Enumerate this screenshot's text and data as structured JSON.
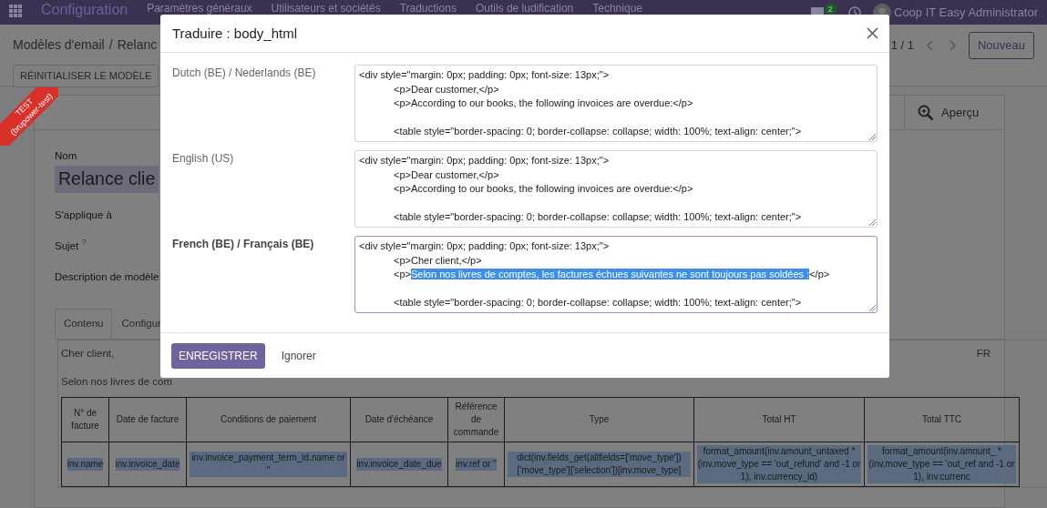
{
  "navbar": {
    "brand": "Configuration",
    "menus": [
      "Paramètres généraux",
      "Utilisateurs et sociétés",
      "Traductions",
      "Outils de ludification",
      "Technique"
    ],
    "message_count": "2",
    "user": "Coop IT Easy Administrator"
  },
  "ribbon": {
    "lines": [
      "TEST",
      "(brupower-test)"
    ]
  },
  "control_panel": {
    "breadcrumbs": [
      "Modèles d'email",
      "Relanc"
    ],
    "breadcrumb_separator": "/",
    "action_button": "RÉINITIALISER LE MODÈLE",
    "pager": "1 / 1",
    "new_button": "Nouveau"
  },
  "form": {
    "stat_button": "Aperçu",
    "fields": [
      {
        "label": "Nom",
        "kind": "title"
      },
      {
        "label": "S'applique à",
        "kind": "plain"
      },
      {
        "label": "Sujet",
        "kind": "help",
        "help": "?"
      },
      {
        "label": "Description de modèle",
        "kind": "plain"
      }
    ],
    "name_value": "Relance clie",
    "tabs": [
      {
        "label": "Contenu",
        "selected": true
      },
      {
        "label": "Configur",
        "selected": false
      }
    ],
    "body": {
      "greeting": "Cher client,",
      "language": "FR",
      "intro": "Selon nos livres de com",
      "table": {
        "columns": [
          "N° de facture",
          "Date de facture",
          "Conditions de paiement",
          "Date d'échéance",
          "Référence de commande",
          "Type",
          "Total HT",
          "Total TTC"
        ],
        "rows": [
          {
            "selected": true,
            "cells": [
              "inv.name",
              "inv.invoice_date",
              "inv.invoice_payment_term_id.name or ''",
              "inv.invoice_date_due",
              "inv.ref or ''",
              "dict(inv.fields_get(allfields=['move_type'])['move_type']['selection'])[inv.move_type]",
              "format_amount(inv.amount_untaxed * (inv.move_type == 'out_refund' and -1 or 1), inv.currency_id)",
              "format_amount(inv.amount_ * (inv.move_type == 'out_ref and -1 or 1), inv.currenc"
            ]
          }
        ]
      }
    }
  },
  "modal": {
    "title": "Traduire : body_html",
    "rows": [
      {
        "language": "Dutch (BE) / Nederlands (BE)",
        "focused": false,
        "lines": [
          {
            "text": "<div style=\"margin: 0px; padding: 0px; font-size: 13px;\">",
            "indented": false
          },
          {
            "text": "<p>Dear customer,</p>",
            "indented": true
          },
          {
            "text": "<p>According to our books, the following invoices are overdue:</p>",
            "indented": true
          },
          {
            "text": "<table style=\"border-spacing: 0; border-collapse: collapse; width: 100%; text-align: center;\">",
            "indented": true,
            "gap_before": true
          }
        ]
      },
      {
        "language": "English (US)",
        "focused": false,
        "lines": [
          {
            "text": "<div style=\"margin: 0px; padding: 0px; font-size: 13px;\">",
            "indented": false
          },
          {
            "text": "<p>Dear customer,</p>",
            "indented": true
          },
          {
            "text": "<p>According to our books, the following invoices are overdue:</p>",
            "indented": true
          },
          {
            "text": "<table style=\"border-spacing: 0; border-collapse: collapse; width: 100%; text-align: center;\">",
            "indented": true,
            "gap_before": true
          }
        ]
      },
      {
        "language": "French (BE) / Français (BE)",
        "focused": true,
        "lines": [
          {
            "text": "<div style=\"margin: 0px; padding: 0px; font-size: 13px;\">",
            "indented": false
          },
          {
            "text": "<p>Cher client,</p>",
            "indented": true
          },
          {
            "segments": [
              {
                "text": "<p>",
                "selected": false
              },
              {
                "text": "Selon nos livres de comptes, les factures échues suivantes ne sont toujours pas soldées :",
                "selected": true
              },
              {
                "text": "</p>",
                "selected": false
              }
            ],
            "indented": true
          },
          {
            "text": "<table style=\"border-spacing: 0; border-collapse: collapse; width: 100%; text-align: center;\">",
            "indented": true,
            "gap_before": true
          }
        ]
      }
    ],
    "save_button": "ENREGISTRER",
    "discard_button": "Ignorer"
  }
}
